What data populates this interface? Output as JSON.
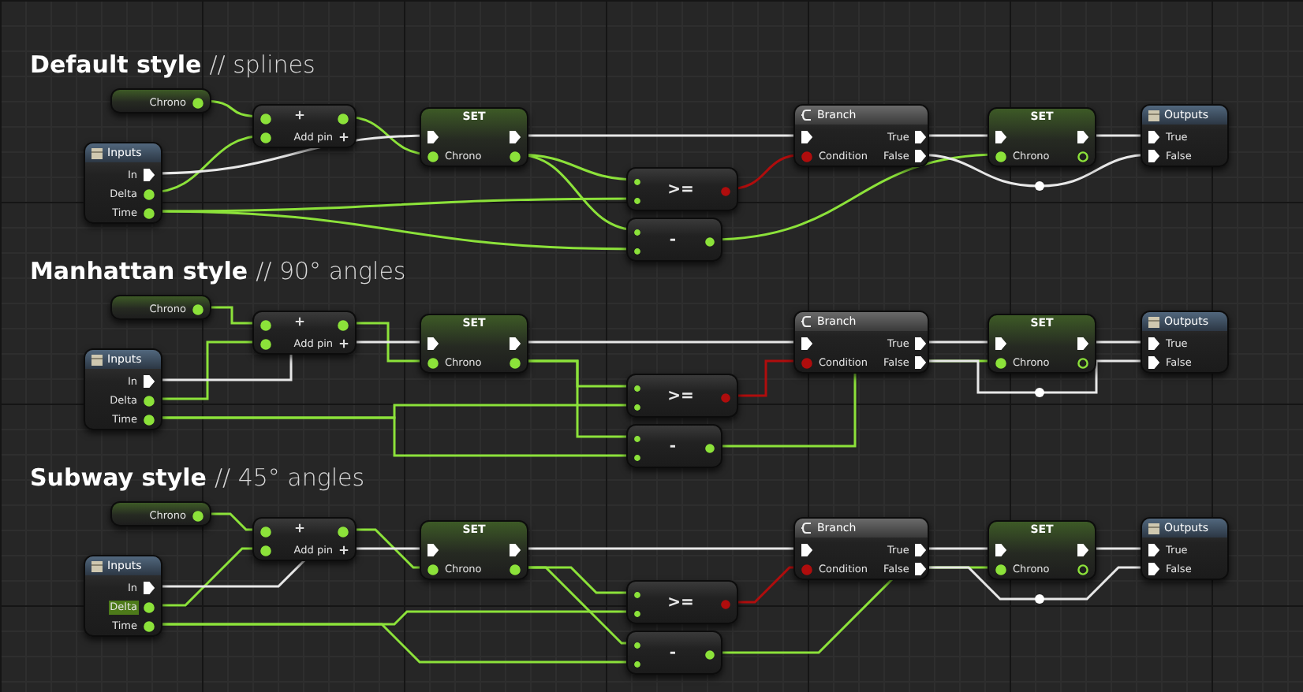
{
  "sections": [
    {
      "title": "Default style",
      "subtitle": "// splines",
      "kind": "spline",
      "nodes": [
        {
          "kind": "variable",
          "pins": [
            {
              "label": "Chrono"
            }
          ]
        },
        {
          "kind": "add",
          "label": "Add pin"
        },
        {
          "kind": "inputs",
          "title": "Inputs",
          "pins": [
            {
              "label": "In",
              "selected": false
            },
            {
              "label": "Delta",
              "selected": false
            },
            {
              "label": "Time",
              "selected": false
            }
          ]
        },
        {
          "kind": "set",
          "title": "SET",
          "pins": [
            {
              "label": "Chrono"
            }
          ]
        },
        {
          "kind": "operator",
          "symbol": ">="
        },
        {
          "kind": "operator",
          "symbol": "-"
        },
        {
          "kind": "branch",
          "title": "Branch",
          "pins": [
            {
              "label": "Condition"
            },
            {
              "label": "True"
            },
            {
              "label": "False"
            }
          ]
        },
        {
          "kind": "set",
          "title": "SET",
          "pins": [
            {
              "label": "Chrono"
            }
          ]
        },
        {
          "kind": "outputs",
          "title": "Outputs",
          "pins": [
            {
              "label": "True"
            },
            {
              "label": "False"
            }
          ]
        }
      ]
    },
    {
      "title": "Manhattan style",
      "subtitle": "// 90° angles",
      "kind": "manhattan",
      "nodes": [
        {
          "kind": "variable",
          "pins": [
            {
              "label": "Chrono"
            }
          ]
        },
        {
          "kind": "add",
          "label": "Add pin"
        },
        {
          "kind": "inputs",
          "title": "Inputs",
          "pins": [
            {
              "label": "In",
              "selected": false
            },
            {
              "label": "Delta",
              "selected": false
            },
            {
              "label": "Time",
              "selected": false
            }
          ]
        },
        {
          "kind": "set",
          "title": "SET",
          "pins": [
            {
              "label": "Chrono"
            }
          ]
        },
        {
          "kind": "operator",
          "symbol": ">="
        },
        {
          "kind": "operator",
          "symbol": "-"
        },
        {
          "kind": "branch",
          "title": "Branch",
          "pins": [
            {
              "label": "Condition"
            },
            {
              "label": "True"
            },
            {
              "label": "False"
            }
          ]
        },
        {
          "kind": "set",
          "title": "SET",
          "pins": [
            {
              "label": "Chrono"
            }
          ]
        },
        {
          "kind": "outputs",
          "title": "Outputs",
          "pins": [
            {
              "label": "True"
            },
            {
              "label": "False"
            }
          ]
        }
      ]
    },
    {
      "title": "Subway style",
      "subtitle": "// 45° angles",
      "kind": "subway",
      "nodes": [
        {
          "kind": "variable",
          "pins": [
            {
              "label": "Chrono"
            }
          ]
        },
        {
          "kind": "add",
          "label": "Add pin"
        },
        {
          "kind": "inputs",
          "title": "Inputs",
          "pins": [
            {
              "label": "In",
              "selected": false
            },
            {
              "label": "Delta",
              "selected": true
            },
            {
              "label": "Time",
              "selected": false
            }
          ]
        },
        {
          "kind": "set",
          "title": "SET",
          "pins": [
            {
              "label": "Chrono"
            }
          ]
        },
        {
          "kind": "operator",
          "symbol": ">="
        },
        {
          "kind": "operator",
          "symbol": "-"
        },
        {
          "kind": "branch",
          "title": "Branch",
          "pins": [
            {
              "label": "Condition"
            },
            {
              "label": "True"
            },
            {
              "label": "False"
            }
          ]
        },
        {
          "kind": "set",
          "title": "SET",
          "pins": [
            {
              "label": "Chrono"
            }
          ]
        },
        {
          "kind": "outputs",
          "title": "Outputs",
          "pins": [
            {
              "label": "True"
            },
            {
              "label": "False"
            }
          ]
        }
      ]
    }
  ]
}
